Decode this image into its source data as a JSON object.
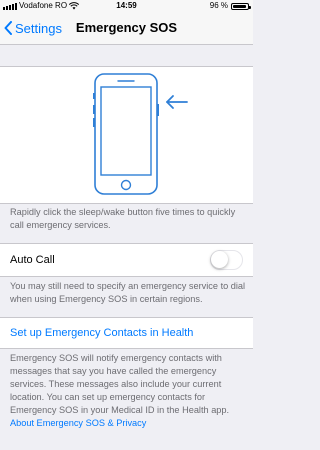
{
  "status_bar": {
    "carrier": "Vodafone RO",
    "time": "14:59",
    "battery_percent": "96 %",
    "battery_level": 0.96
  },
  "nav": {
    "back_label": "Settings",
    "title": "Emergency SOS"
  },
  "illustration": {
    "icons": [
      "iphone-outline-icon",
      "left-arrow-icon"
    ],
    "accent_color": "#2f7fd6"
  },
  "illustration_caption": "Rapidly click the sleep/wake button five times to quickly call emergency services.",
  "auto_call": {
    "label": "Auto Call",
    "enabled": false,
    "footer": "You may still need to specify an emergency service to dial when using Emergency SOS in certain regions."
  },
  "emergency_contacts": {
    "link_label": "Set up Emergency Contacts in Health",
    "footer": "Emergency SOS will notify emergency contacts with messages that say you have called the emergency services. These messages also include your current location. You can set up emergency contacts for Emergency SOS in your Medical ID in the Health app.",
    "footer_link": "About Emergency SOS & Privacy"
  },
  "colors": {
    "background": "#efeff4",
    "tint": "#007aff",
    "secondary_text": "#6d6d72",
    "separator": "#c8c7cc"
  }
}
